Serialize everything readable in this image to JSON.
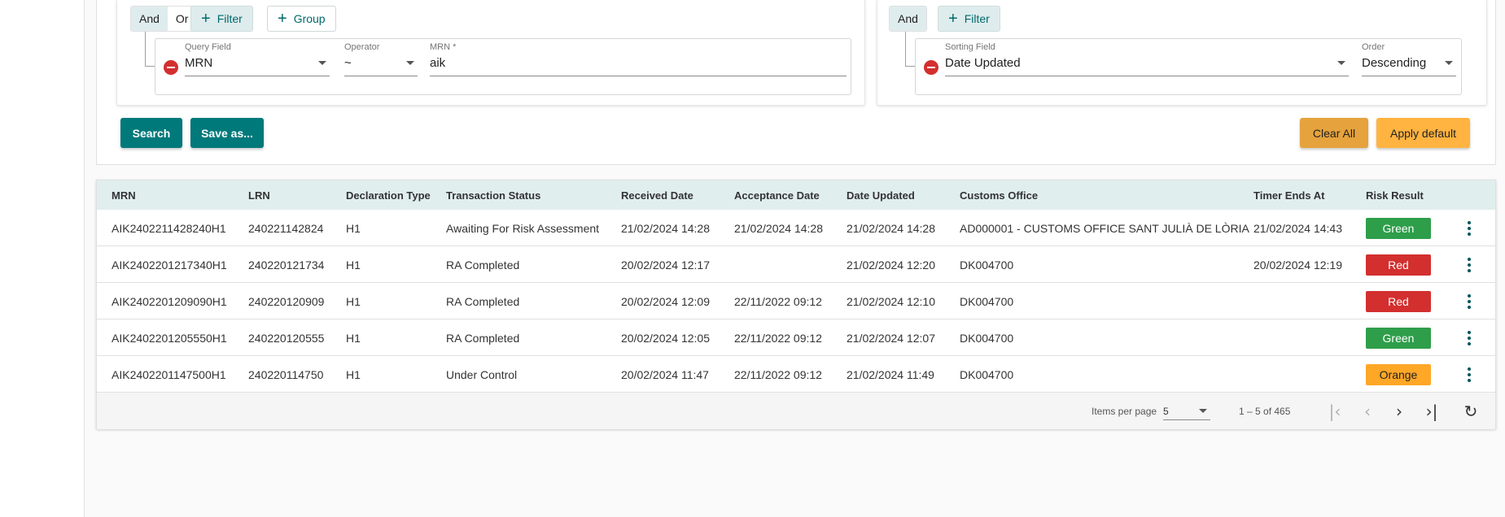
{
  "query_panel": {
    "toggle": [
      "And",
      "Or"
    ],
    "active_toggle": "And",
    "filter_label": "Filter",
    "group_label": "Group",
    "rule": {
      "query_field_label": "Query Field",
      "query_field_value": "MRN",
      "operator_label": "Operator",
      "operator_value": "~",
      "value_label": "MRN *",
      "value": "aik"
    }
  },
  "sort_panel": {
    "toggle": [
      "And"
    ],
    "filter_label": "Filter",
    "rule": {
      "sorting_field_label": "Sorting Field",
      "sorting_field_value": "Date Updated",
      "order_label": "Order",
      "order_value": "Descending"
    }
  },
  "actions": {
    "search": "Search",
    "save_as": "Save as...",
    "clear_all": "Clear All",
    "apply_default": "Apply default"
  },
  "table": {
    "columns": [
      "MRN",
      "LRN",
      "Declaration Type",
      "Transaction Status",
      "Received Date",
      "Acceptance Date",
      "Date Updated",
      "Customs Office",
      "Timer Ends At",
      "Risk Result"
    ],
    "rows": [
      [
        "AIK2402211428240H1",
        "240221142824",
        "H1",
        "Awaiting For Risk Assessment",
        "21/02/2024 14:28",
        "21/02/2024 14:28",
        "21/02/2024 14:28",
        "AD000001 - CUSTOMS OFFICE SANT JULIÀ DE LÒRIA",
        "21/02/2024 14:43",
        "Green"
      ],
      [
        "AIK2402201217340H1",
        "240220121734",
        "H1",
        "RA Completed",
        "20/02/2024 12:17",
        "",
        "21/02/2024 12:20",
        "DK004700",
        "20/02/2024 12:19",
        "Red"
      ],
      [
        "AIK2402201209090H1",
        "240220120909",
        "H1",
        "RA Completed",
        "20/02/2024 12:09",
        "22/11/2022 09:12",
        "21/02/2024 12:10",
        "DK004700",
        "",
        "Red"
      ],
      [
        "AIK2402201205550H1",
        "240220120555",
        "H1",
        "RA Completed",
        "20/02/2024 12:05",
        "22/11/2022 09:12",
        "21/02/2024 12:07",
        "DK004700",
        "",
        "Green"
      ],
      [
        "AIK2402201147500H1",
        "240220114750",
        "H1",
        "Under Control",
        "20/02/2024 11:47",
        "22/11/2022 09:12",
        "21/02/2024 11:49",
        "DK004700",
        "",
        "Orange"
      ]
    ]
  },
  "risk_colors": {
    "Green": {
      "bg": "#2e9e4a",
      "fg": "#ffffff"
    },
    "Red": {
      "bg": "#d32f2f",
      "fg": "#ffffff"
    },
    "Orange": {
      "bg": "#ffa726",
      "fg": "#222222"
    }
  },
  "paginator": {
    "items_per_page_label": "Items per page",
    "items_per_page_value": "5",
    "range_label": "1 – 5 of 465"
  },
  "icons": {
    "first_page": "first-page-icon",
    "previous_page": "chevron-left-icon",
    "next_page": "chevron-right-icon",
    "last_page": "last-page-icon",
    "refresh": "refresh-icon",
    "row_menu": "more-vert-icon",
    "remove_rule": "remove-circle-icon",
    "add": "plus-icon",
    "dropdown": "caret-down-icon"
  }
}
